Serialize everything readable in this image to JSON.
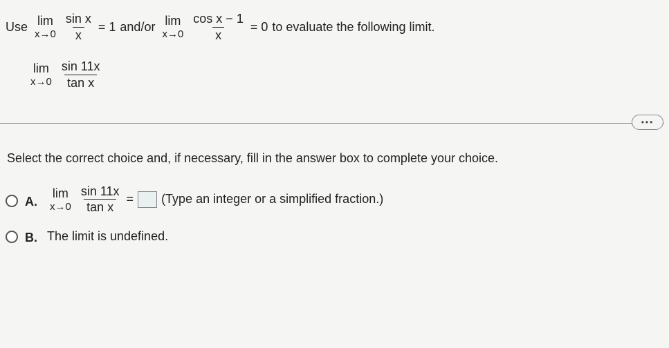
{
  "problem": {
    "use": "Use",
    "lim": "lim",
    "limTo": "x→0",
    "frac1_num": "sin x",
    "frac1_den": "x",
    "eq1": "= 1",
    "andor": "and/or",
    "frac2_num": "cos x − 1",
    "frac2_den": "x",
    "eq2": "= 0",
    "tail": "to evaluate the following limit."
  },
  "target": {
    "lim": "lim",
    "limTo": "x→0",
    "num": "sin 11x",
    "den": "tan x"
  },
  "dots": "•••",
  "instruction": "Select the correct choice and, if necessary, fill in the answer box to complete your choice.",
  "choiceA": {
    "label": "A.",
    "lim": "lim",
    "limTo": "x→0",
    "num": "sin 11x",
    "den": "tan x",
    "eq": "=",
    "hint": "(Type an integer or a simplified fraction.)"
  },
  "choiceB": {
    "label": "B.",
    "text": "The limit is undefined."
  }
}
